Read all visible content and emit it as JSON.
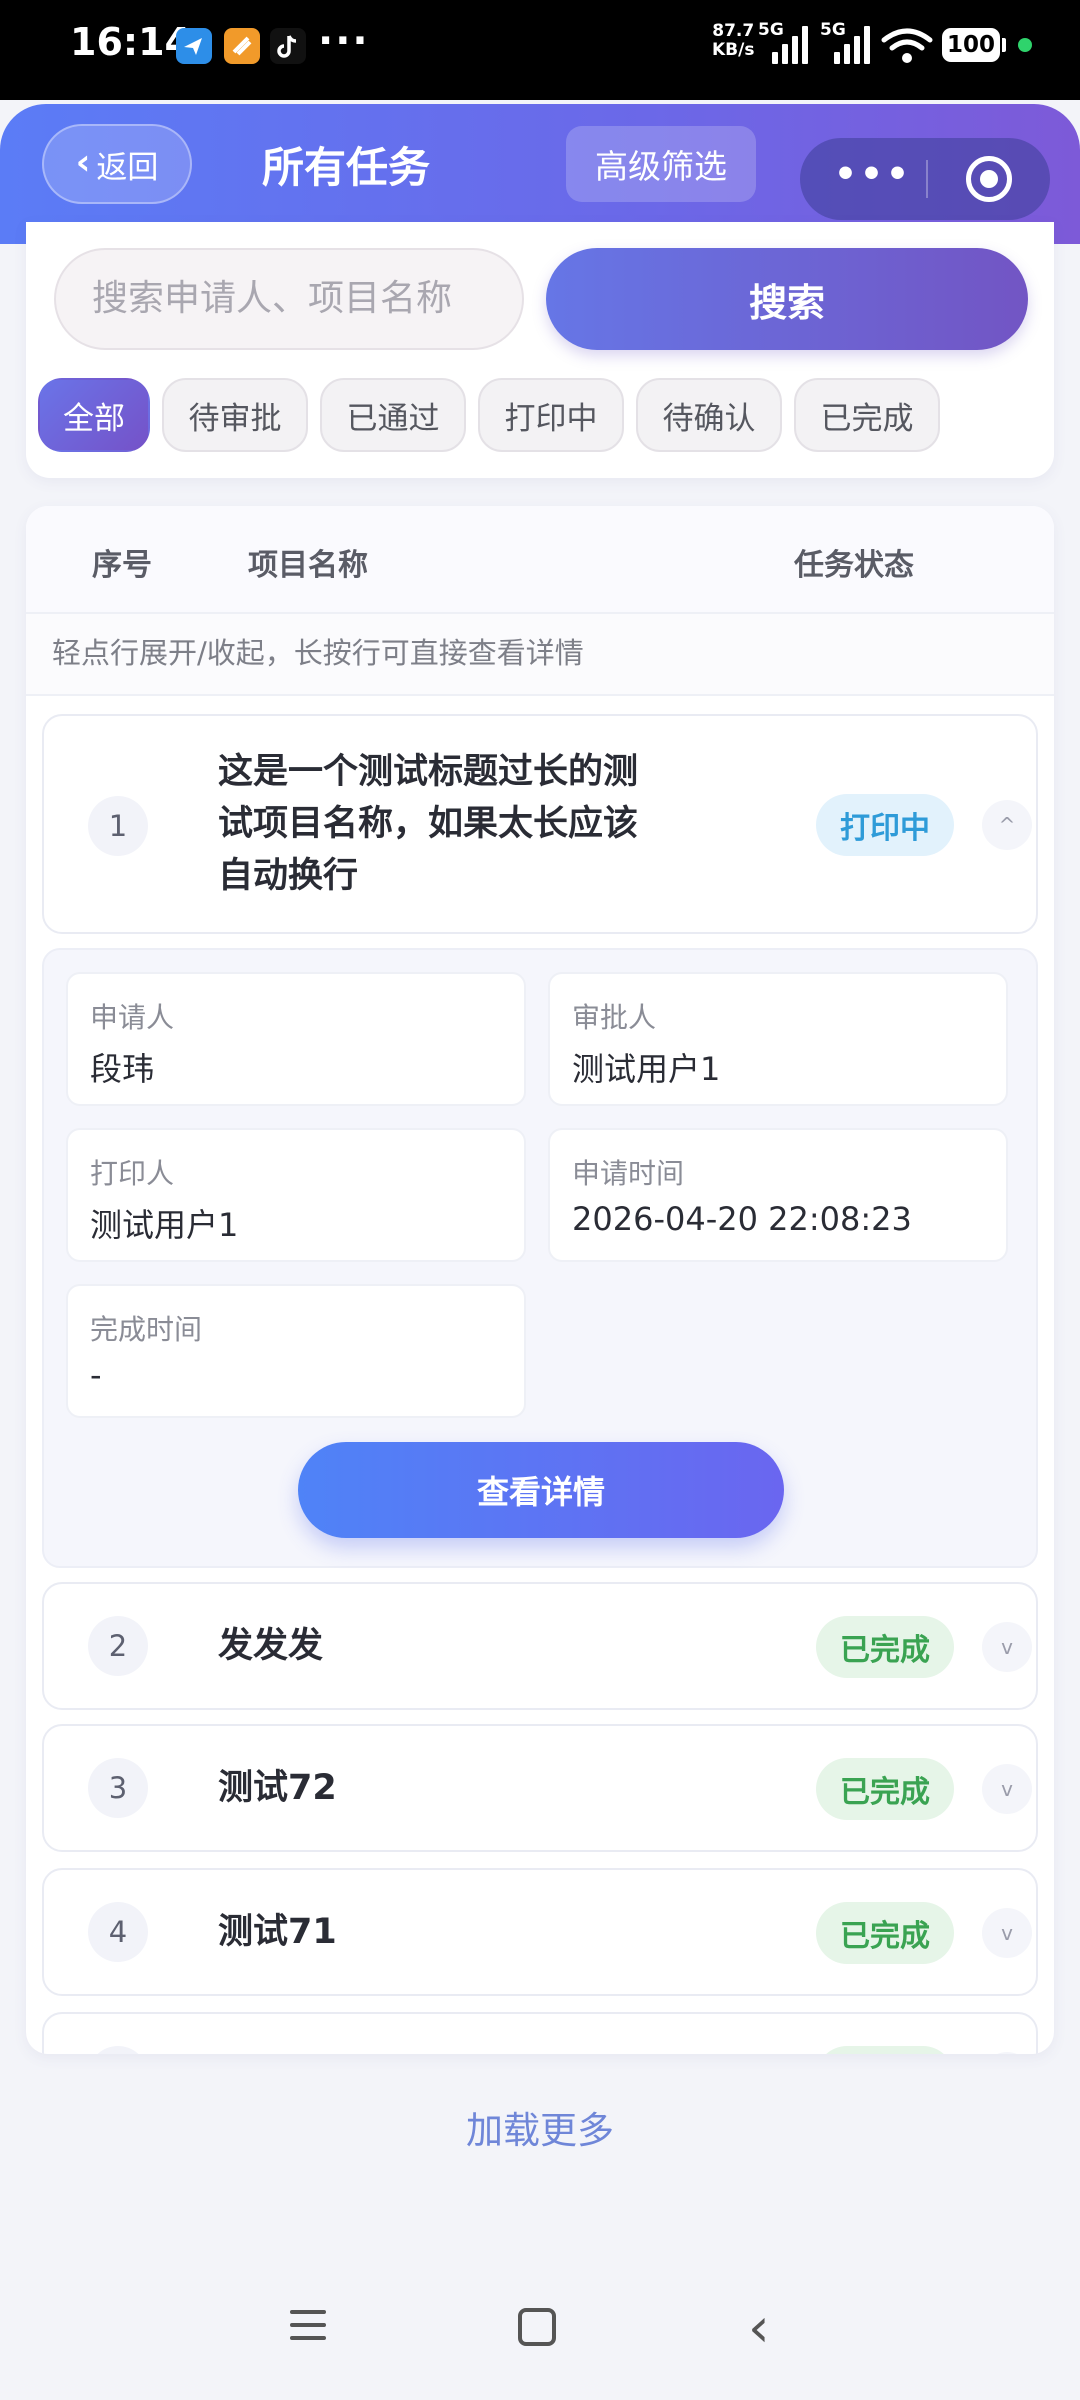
{
  "status_bar": {
    "time": "16:14",
    "more": "···",
    "speed_value": "87.7",
    "speed_unit": "KB/s",
    "net1": "5G",
    "net2": "5G",
    "battery": "100",
    "icons": [
      "app-icon-blue",
      "app-icon-orange",
      "tiktok-icon"
    ]
  },
  "header": {
    "back_label": "返回",
    "title": "所有任务",
    "advanced_filter_label": "高级筛选",
    "capsule_more": "•••"
  },
  "search": {
    "placeholder": "搜索申请人、项目名称",
    "button_label": "搜索"
  },
  "filters": [
    {
      "label": "全部",
      "active": true
    },
    {
      "label": "待审批",
      "active": false
    },
    {
      "label": "已通过",
      "active": false
    },
    {
      "label": "打印中",
      "active": false
    },
    {
      "label": "待确认",
      "active": false
    },
    {
      "label": "已完成",
      "active": false
    }
  ],
  "table": {
    "headers": {
      "index": "序号",
      "name": "项目名称",
      "status": "任务状态"
    },
    "hint": "轻点行展开/收起，长按行可直接查看详情",
    "rows": [
      {
        "index": "1",
        "name_lines": [
          "这是一个测试标题过长的测",
          "试项目名称，如果太长应该",
          "自动换行"
        ],
        "status": "打印中",
        "toggle": "^"
      },
      {
        "index": "2",
        "name": "发发发",
        "status": "已完成",
        "toggle": "v"
      },
      {
        "index": "3",
        "name": "测试72",
        "status": "已完成",
        "toggle": "v"
      },
      {
        "index": "4",
        "name": "测试71",
        "status": "已完成",
        "toggle": "v"
      }
    ],
    "detail": {
      "applicant_label": "申请人",
      "applicant": "段玮",
      "approver_label": "审批人",
      "approver": "测试用户1",
      "printer_label": "打印人",
      "printer": "测试用户1",
      "apply_time_label": "申请时间",
      "apply_time": "2026-04-20 22:08:23",
      "finish_time_label": "完成时间",
      "finish_time": "-",
      "view_detail_label": "查看详情"
    }
  },
  "load_more": "加载更多",
  "colors": {
    "header_gradient_start": "#5b7cf6",
    "header_gradient_end": "#7d5ad8",
    "printing_text": "#2e9bd8",
    "done_text": "#3aa352",
    "load_more_text": "#6f86d8"
  }
}
